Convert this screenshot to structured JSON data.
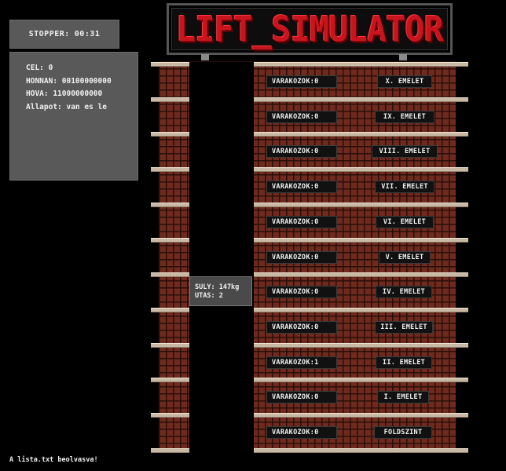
{
  "stopper": {
    "label": "STOPPER:",
    "time": "00:31"
  },
  "info": {
    "cel": "CEL: 0",
    "honnan": "HONNAN: 00100000000",
    "hova": "HOVA: 11000000000",
    "allapot": "Allapot: van es le"
  },
  "title": "LIFT_SIMULATOR",
  "floors": [
    {
      "waiting": "VARAKOZOK:0",
      "name": "X. EMELET"
    },
    {
      "waiting": "VARAKOZOK:0",
      "name": "IX. EMELET"
    },
    {
      "waiting": "VARAKOZOK:0",
      "name": "VIII. EMELET"
    },
    {
      "waiting": "VARAKOZOK:0",
      "name": "VII. EMELET"
    },
    {
      "waiting": "VARAKOZOK:0",
      "name": "VI. EMELET"
    },
    {
      "waiting": "VARAKOZOK:0",
      "name": "V. EMELET"
    },
    {
      "waiting": "VARAKOZOK:0",
      "name": "IV. EMELET"
    },
    {
      "waiting": "VARAKOZOK:0",
      "name": "III. EMELET"
    },
    {
      "waiting": "VARAKOZOK:1",
      "name": "II. EMELET"
    },
    {
      "waiting": "VARAKOZOK:0",
      "name": "I. EMELET"
    },
    {
      "waiting": "VARAKOZOK:0",
      "name": "FOLDSZINT"
    }
  ],
  "cabin": {
    "suly": "SULY: 147kg",
    "utas": "UTAS: 2"
  },
  "status": "A lista.txt beolvasva!",
  "colors": {
    "background": "#000000",
    "panel": "#595959",
    "title": "#c8141c",
    "brick": "#6e2a1e"
  }
}
